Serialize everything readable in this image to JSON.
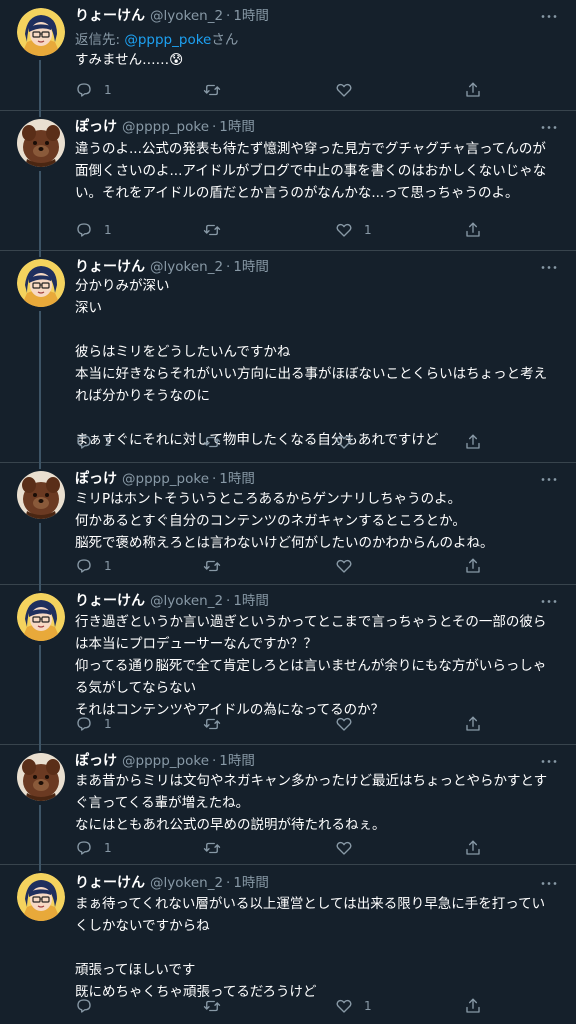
{
  "colors": {
    "background": "#15202b",
    "divider": "#38444d",
    "secondary_text": "#8899a6",
    "link": "#1da1f2"
  },
  "icons": {
    "more": "more-horizontal-icon",
    "reply": "reply-bubble-icon",
    "retweet": "retweet-arrows-icon",
    "like": "heart-icon",
    "share": "share-upload-icon"
  },
  "more_glyph": "•••",
  "tweets": [
    {
      "author": "りょーけん",
      "handle": "@lyoken_2",
      "separator": "·",
      "time": "1時間",
      "replying_prefix": "返信先: ",
      "replying_to": "@pppp_poke",
      "replying_suffix": "さん",
      "text": "すみません……😰",
      "reply_count": "1",
      "retweet_count": "",
      "like_count": "",
      "avatar": "ryoken"
    },
    {
      "author": "ぽっけ",
      "handle": "@pppp_poke",
      "separator": "·",
      "time": "1時間",
      "text": "違うのよ...公式の発表も待たず憶測や穿った見方でグチャグチャ言ってんのが面倒くさいのよ...アイドルがブログで中止の事を書くのはおかしくないじゃない。それをアイドルの盾だとか言うのがなんかな...って思っちゃうのよ。",
      "reply_count": "1",
      "retweet_count": "",
      "like_count": "1",
      "avatar": "pokke"
    },
    {
      "author": "りょーけん",
      "handle": "@lyoken_2",
      "separator": "·",
      "time": "1時間",
      "text": "分かりみが深い\n深い\n\n彼らはミリをどうしたいんですかね\n本当に好きならそれがいい方向に出る事がほぼないことくらいはちょっと考えれば分かりそうなのに\n\nまぁすぐにそれに対して物申したくなる自分もあれですけど",
      "reply_count": "1",
      "retweet_count": "",
      "like_count": "",
      "avatar": "ryoken"
    },
    {
      "author": "ぽっけ",
      "handle": "@pppp_poke",
      "separator": "·",
      "time": "1時間",
      "text": "ミリPはホントそういうところあるからゲンナリしちゃうのよ。\n何かあるとすぐ自分のコンテンツのネガキャンするところとか。\n脳死で褒め称えろとは言わないけど何がしたいのかわからんのよね。",
      "reply_count": "1",
      "retweet_count": "",
      "like_count": "",
      "avatar": "pokke"
    },
    {
      "author": "りょーけん",
      "handle": "@lyoken_2",
      "separator": "·",
      "time": "1時間",
      "text": "行き過ぎというか言い過ぎというかってとこまで言っちゃうとその一部の彼らは本当にプロデューサーなんですか？？\n仰ってる通り脳死で全て肯定しろとは言いませんが余りにもな方がいらっしゃる気がしてならない\nそれはコンテンツやアイドルの為になってるのか？",
      "reply_count": "1",
      "retweet_count": "",
      "like_count": "",
      "avatar": "ryoken"
    },
    {
      "author": "ぽっけ",
      "handle": "@pppp_poke",
      "separator": "·",
      "time": "1時間",
      "text": "まあ昔からミリは文句やネガキャン多かったけど最近はちょっとやらかすとすぐ言ってくる輩が増えたね。\nなにはともあれ公式の早めの説明が待たれるねぇ。",
      "reply_count": "1",
      "retweet_count": "",
      "like_count": "",
      "avatar": "pokke"
    },
    {
      "author": "りょーけん",
      "handle": "@lyoken_2",
      "separator": "·",
      "time": "1時間",
      "text": "まぁ待ってくれない層がいる以上運営としては出来る限り早急に手を打っていくしかないですからね\n\n頑張ってほしいです\n既にめちゃくちゃ頑張ってるだろうけど",
      "reply_count": "",
      "retweet_count": "",
      "like_count": "1",
      "avatar": "ryoken"
    }
  ]
}
